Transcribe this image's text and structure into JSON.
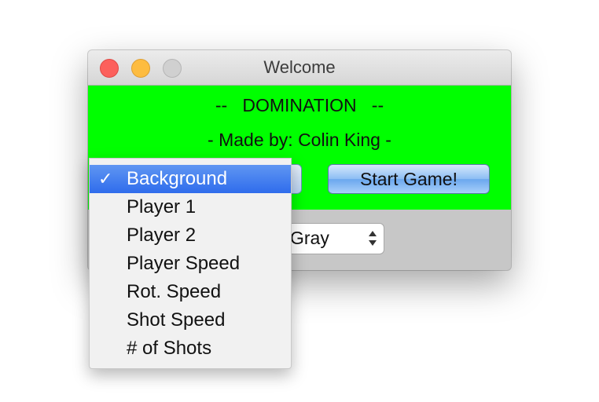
{
  "window": {
    "title": "Welcome"
  },
  "header": {
    "title_line": "--   DOMINATION   --",
    "credit_line": "- Made by: Colin King -"
  },
  "buttons": {
    "start_label": "Start Game!"
  },
  "color_select": {
    "value": "Gray"
  },
  "dropdown": {
    "checkmark": "✓",
    "items": [
      {
        "label": "Background",
        "selected": true
      },
      {
        "label": "Player 1",
        "selected": false
      },
      {
        "label": "Player 2",
        "selected": false
      },
      {
        "label": "Player Speed",
        "selected": false
      },
      {
        "label": "Rot. Speed",
        "selected": false
      },
      {
        "label": "Shot Speed",
        "selected": false
      },
      {
        "label": "# of Shots",
        "selected": false
      }
    ]
  },
  "colors": {
    "panel_green": "#00ff00",
    "selection_blue": "#3d7bef",
    "close": "#fc605c",
    "minimize": "#fdbc40",
    "zoom": "#d0d0d0"
  },
  "icons": [
    "close-icon",
    "minimize-icon",
    "zoom-icon",
    "checkmark-icon",
    "up-down-arrows-icon"
  ]
}
